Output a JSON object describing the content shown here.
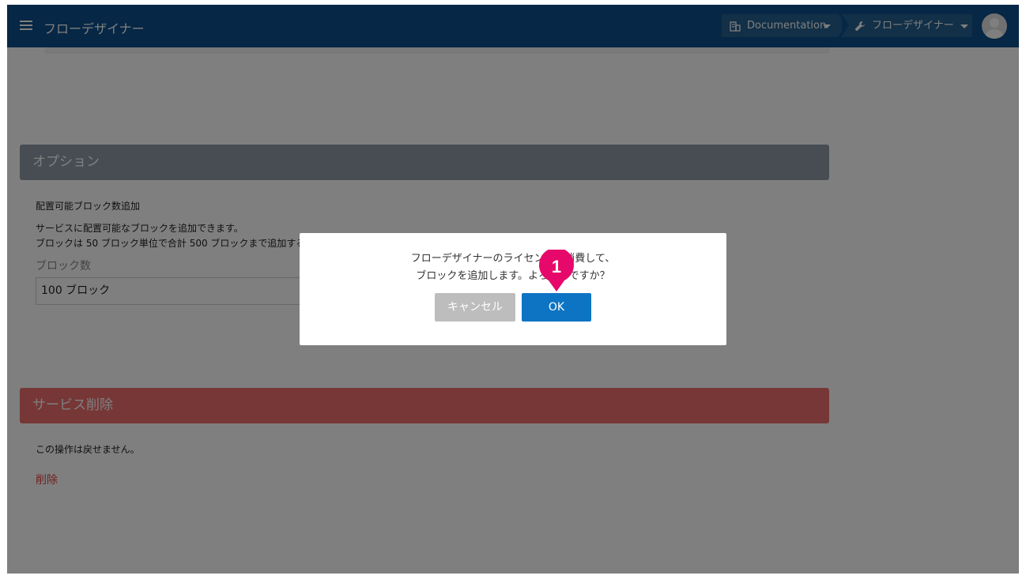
{
  "header": {
    "app_title": "フローデザイナー",
    "breadcrumb": [
      {
        "label": "Documentation",
        "icon": "building-icon"
      },
      {
        "label": "フローデザイナー",
        "icon": "wrench-icon"
      }
    ],
    "colors": {
      "bar": "#0d4e8b",
      "crumb": "#25608f"
    }
  },
  "options": {
    "header": "オプション",
    "section_title": "配置可能ブロック数追加",
    "description_line1": "サービスに配置可能なブロックを追加できます。",
    "description_line2": "ブロックは 50 ブロック単位で合計 500 ブロックまで追加する",
    "field_label": "ブロック数",
    "selected_value": "100 ブロック"
  },
  "delete_section": {
    "header": "サービス削除",
    "warning": "この操作は戻せません。",
    "link": "削除",
    "color": "#ee6f6f"
  },
  "dialog": {
    "message_line1": "フローデザイナーのライセンスを消費して、",
    "message_line2": "ブロックを追加します。よろしいですか？",
    "cancel_label": "キャンセル",
    "ok_label": "OK",
    "ok_color": "#0d74c3"
  },
  "annotation": {
    "label": "1",
    "color": "#e6086a"
  }
}
